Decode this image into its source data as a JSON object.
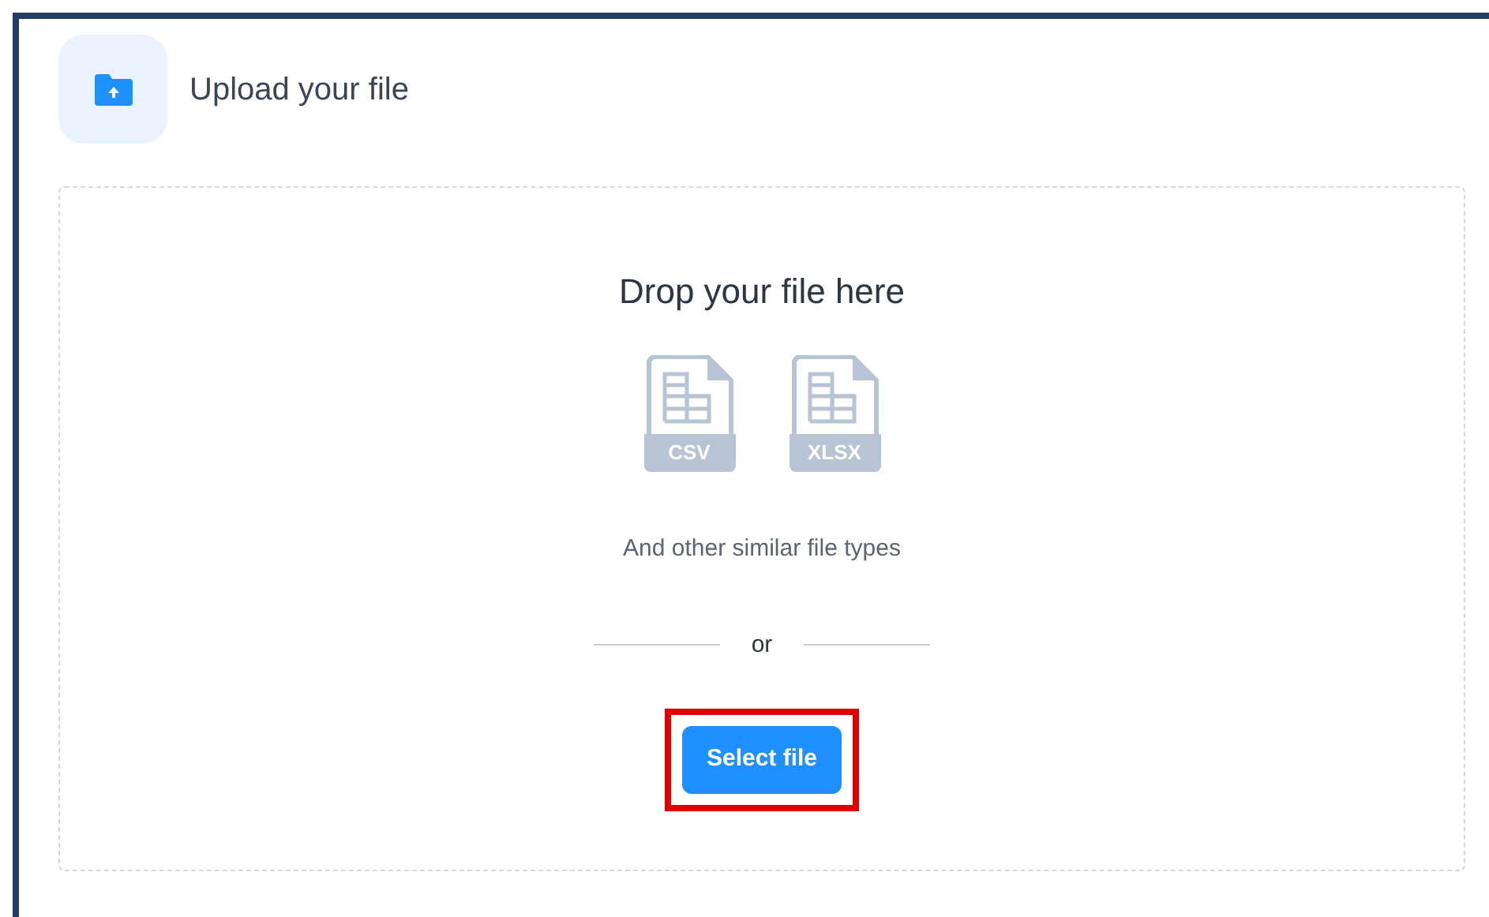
{
  "header": {
    "title": "Upload your file"
  },
  "dropzone": {
    "title": "Drop your file here",
    "file_types": [
      {
        "label": "CSV"
      },
      {
        "label": "XLSX"
      }
    ],
    "note": "And other similar file types",
    "separator": "or",
    "button": {
      "label": "Select file",
      "highlighted": true
    }
  }
}
